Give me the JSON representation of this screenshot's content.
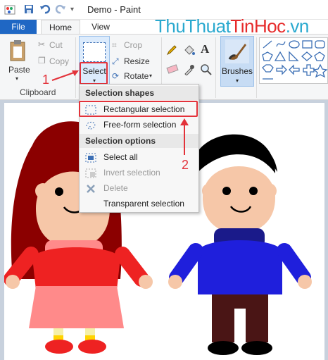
{
  "window": {
    "title": "Demo - Paint"
  },
  "tabs": {
    "file": "File",
    "home": "Home",
    "view": "View"
  },
  "watermark": {
    "part1": "ThuThuat",
    "part2": "TinHoc",
    "part3": ".vn"
  },
  "clipboard": {
    "paste": "Paste",
    "cut": "Cut",
    "copy": "Copy",
    "group_label": "Clipboard"
  },
  "image": {
    "select": "Select",
    "crop": "Crop",
    "resize": "Resize",
    "rotate": "Rotate"
  },
  "tools": {
    "text_tool": "A"
  },
  "brushes": {
    "label": "Brushes"
  },
  "menu": {
    "section_shapes": "Selection shapes",
    "rect": "Rectangular selection",
    "freeform": "Free-form selection",
    "section_options": "Selection options",
    "select_all": "Select all",
    "invert": "Invert selection",
    "delete": "Delete",
    "transparent": "Transparent selection"
  },
  "annotations": {
    "step1": "1",
    "step2": "2"
  },
  "colors": {
    "accent": "#1f67c4",
    "highlight": "#e3323a"
  }
}
